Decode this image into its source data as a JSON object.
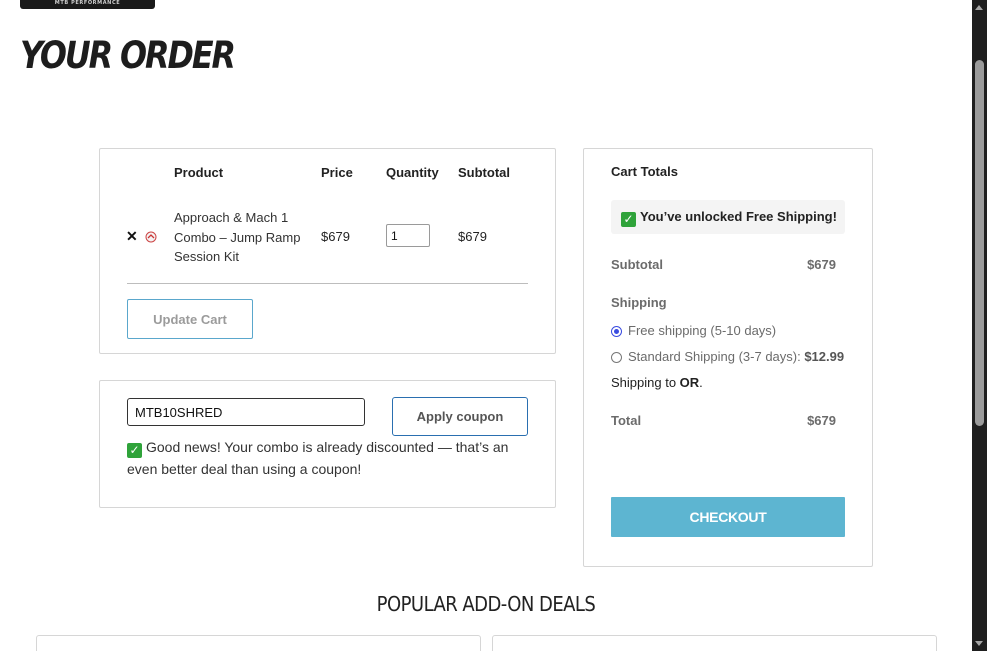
{
  "brand": {
    "logo_text": "MTB PERFORMANCE"
  },
  "page": {
    "title": "YOUR ORDER"
  },
  "cart": {
    "headers": {
      "product": "Product",
      "price": "Price",
      "quantity": "Quantity",
      "subtotal": "Subtotal"
    },
    "items": [
      {
        "name": "Approach & Mach 1 Combo – Jump Ramp Session Kit",
        "price": "$679",
        "quantity": "1",
        "subtotal": "$679"
      }
    ],
    "update_button": "Update Cart"
  },
  "coupon": {
    "code_value": "MTB10SHRED",
    "apply_button": "Apply coupon",
    "message": "Good news! Your combo is already discounted — that’s an even better deal than using a coupon!"
  },
  "totals": {
    "title": "Cart Totals",
    "free_shipping_banner": "You’ve unlocked Free Shipping!",
    "subtotal_label": "Subtotal",
    "subtotal_value": "$679",
    "shipping_label": "Shipping",
    "shipping_options": [
      {
        "label": "Free shipping (5-10 days)",
        "price": "",
        "selected": true
      },
      {
        "label": "Standard Shipping (3-7 days): ",
        "price": "$12.99",
        "selected": false
      }
    ],
    "ship_to_prefix": "Shipping to ",
    "ship_to_state": "OR",
    "ship_to_suffix": ".",
    "total_label": "Total",
    "total_value": "$679",
    "checkout_button": "CHECKOUT"
  },
  "deals": {
    "title": "POPULAR ADD-ON DEALS"
  },
  "colors": {
    "checkout": "#5db5d1",
    "check_green": "#2fa33a",
    "radio_selected": "#3a4ce0",
    "coupon_button_border": "#2a6fb0"
  }
}
